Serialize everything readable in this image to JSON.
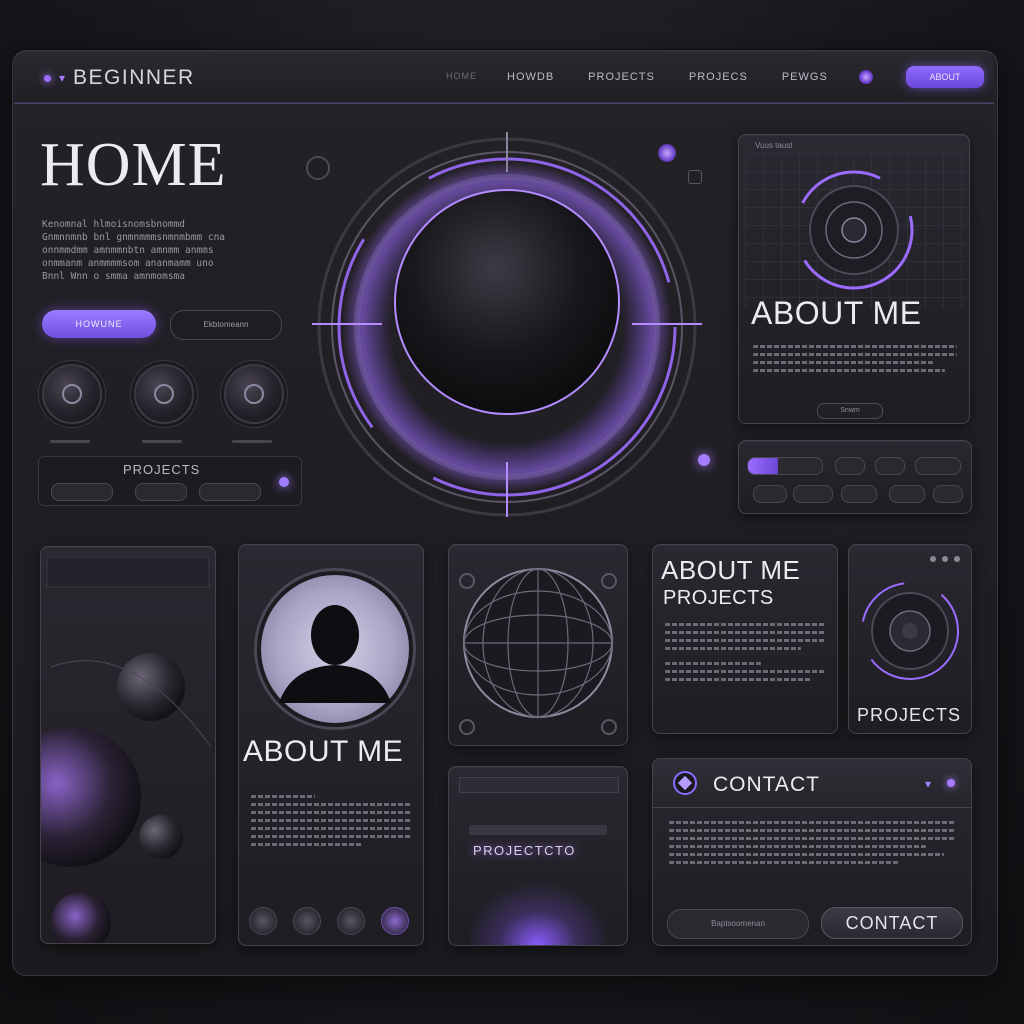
{
  "brand": {
    "name": "BEGINNER"
  },
  "nav": {
    "links": [
      "HOME",
      "HOWDB",
      "PROJECTS",
      "PROJECS",
      "PEWGS"
    ],
    "cta": "ABOUT"
  },
  "hero": {
    "title": "HOME",
    "text": [
      "Kenomnal hlmoisnomsbnommd",
      "Gnmnnmnb bnl gnmnmmmsnmnmbmm cna",
      "onnmmdmm amnmmnbtn amnmm anmms",
      "onmmanm anmmmmsom ananmamm uno",
      "Bnnl Wnn o smma amnmomsma"
    ],
    "primary_button": "HOWUNE",
    "secondary_button": "Ekbtomeann",
    "projects_label": "PROJECTS"
  },
  "about_top": {
    "caption": "Vuus taust",
    "title": "ABOUT ME",
    "button": "Snwm"
  },
  "cards": {
    "profile_title": "ABOUT ME",
    "about_projects_title": "ABOUT ME",
    "about_projects_subtitle": "PROJECTS",
    "projects_card_label": "PROJECTS",
    "projects_screen_label": "PROJECTCTO"
  },
  "contact": {
    "title": "CONTACT",
    "input_placeholder": "Baptsoomenan",
    "button": "CONTACT"
  },
  "colors": {
    "accent": "#9b6cff",
    "background": "#1b1a1e",
    "panel": "#2a2830"
  }
}
